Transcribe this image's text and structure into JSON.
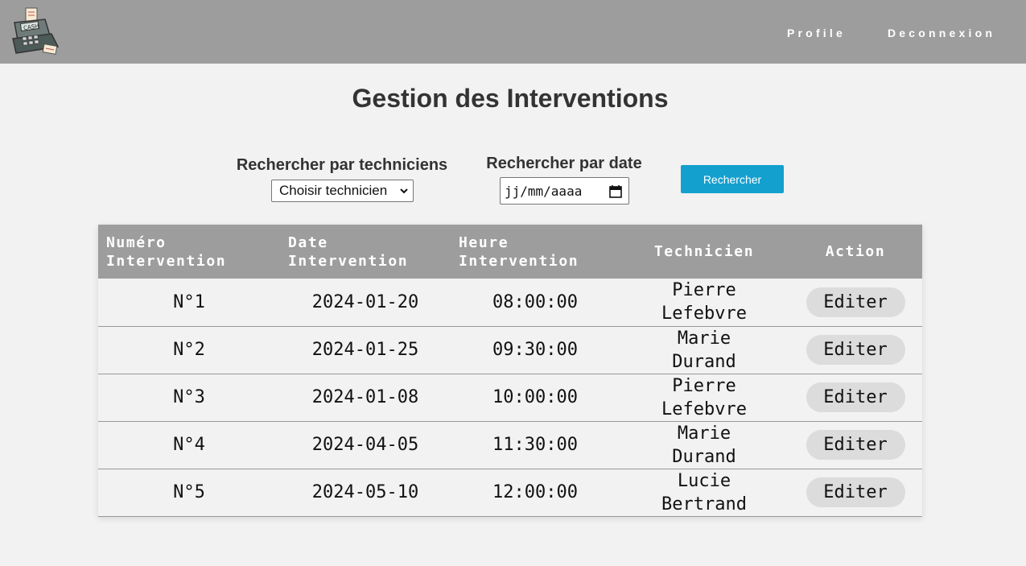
{
  "nav": {
    "links": {
      "profile": "Profile",
      "logout": "Deconnexion"
    },
    "logo_text": "CASH"
  },
  "page": {
    "title": "Gestion des Interventions"
  },
  "filters": {
    "tech_label": "Rechercher par techniciens",
    "tech_select_value": "Choisir technicien",
    "date_label": "Rechercher par date",
    "date_placeholder": "jj/mm/aaaa",
    "search_button": "Rechercher"
  },
  "table": {
    "headers": {
      "num": [
        "Numéro",
        "Intervention"
      ],
      "date": [
        "Date",
        "Intervention"
      ],
      "heure": [
        "Heure",
        "Intervention"
      ],
      "tech": "Technicien",
      "action": "Action"
    },
    "rows": [
      {
        "num": "N°1",
        "date": "2024-01-20",
        "heure": "08:00:00",
        "tech": [
          "Pierre",
          "Lefebvre"
        ],
        "action": "Editer"
      },
      {
        "num": "N°2",
        "date": "2024-01-25",
        "heure": "09:30:00",
        "tech": [
          "Marie",
          "Durand"
        ],
        "action": "Editer"
      },
      {
        "num": "N°3",
        "date": "2024-01-08",
        "heure": "10:00:00",
        "tech": [
          "Pierre",
          "Lefebvre"
        ],
        "action": "Editer"
      },
      {
        "num": "N°4",
        "date": "2024-04-05",
        "heure": "11:30:00",
        "tech": [
          "Marie",
          "Durand"
        ],
        "action": "Editer"
      },
      {
        "num": "N°5",
        "date": "2024-05-10",
        "heure": "12:00:00",
        "tech": [
          "Lucie",
          "Bertrand"
        ],
        "action": "Editer"
      }
    ]
  },
  "colors": {
    "navbar": "#9d9d9d",
    "background": "#f2f2f2",
    "accent": "#14a0cf",
    "edit_button": "#dcdcdc"
  }
}
